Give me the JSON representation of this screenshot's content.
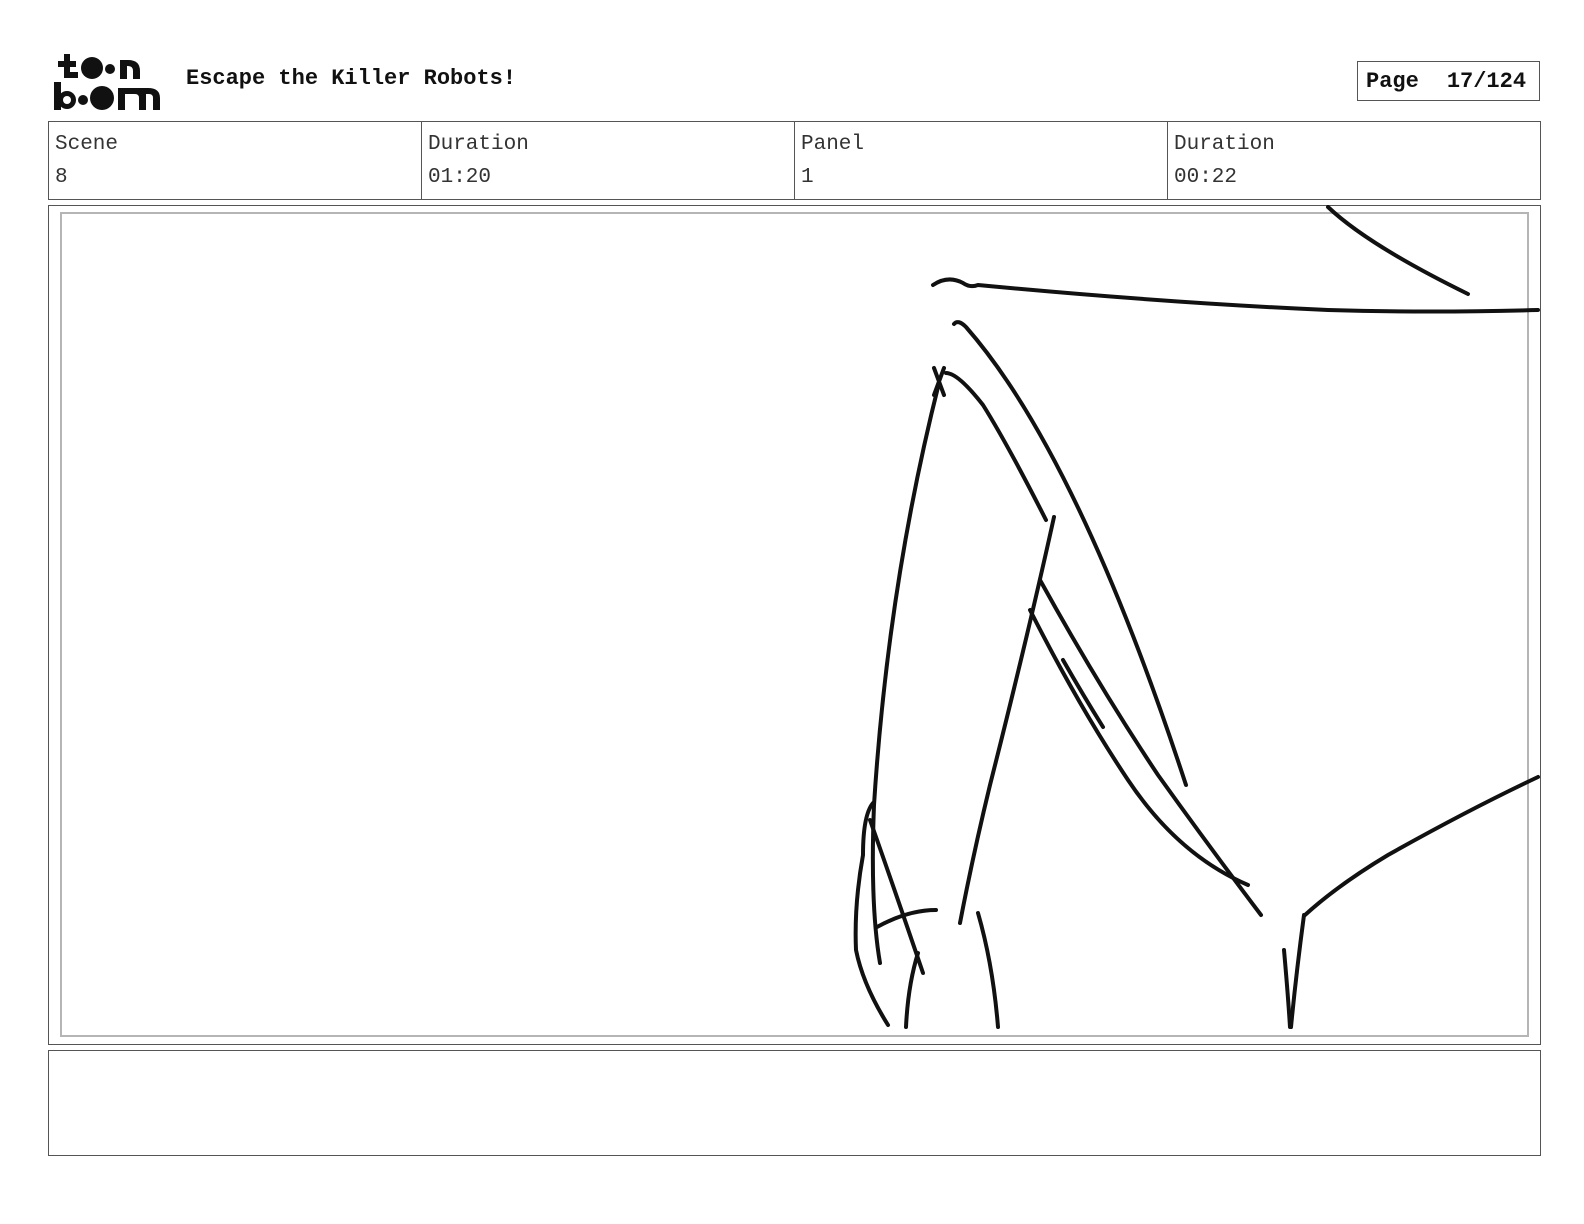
{
  "header": {
    "logo": {
      "icon": "toonboom-logo",
      "text": "toon boom"
    },
    "title": "Escape the Killer Robots!",
    "page": {
      "label": "Page",
      "value": "17/124"
    }
  },
  "info": {
    "cells": [
      {
        "label": "Scene",
        "value": "8"
      },
      {
        "label": "Duration",
        "value": "01:20"
      },
      {
        "label": "Panel",
        "value": "1"
      },
      {
        "label": "Duration",
        "value": "00:22"
      }
    ]
  },
  "panel": {
    "image": "rough-sketch"
  },
  "notes": {
    "text": ""
  }
}
